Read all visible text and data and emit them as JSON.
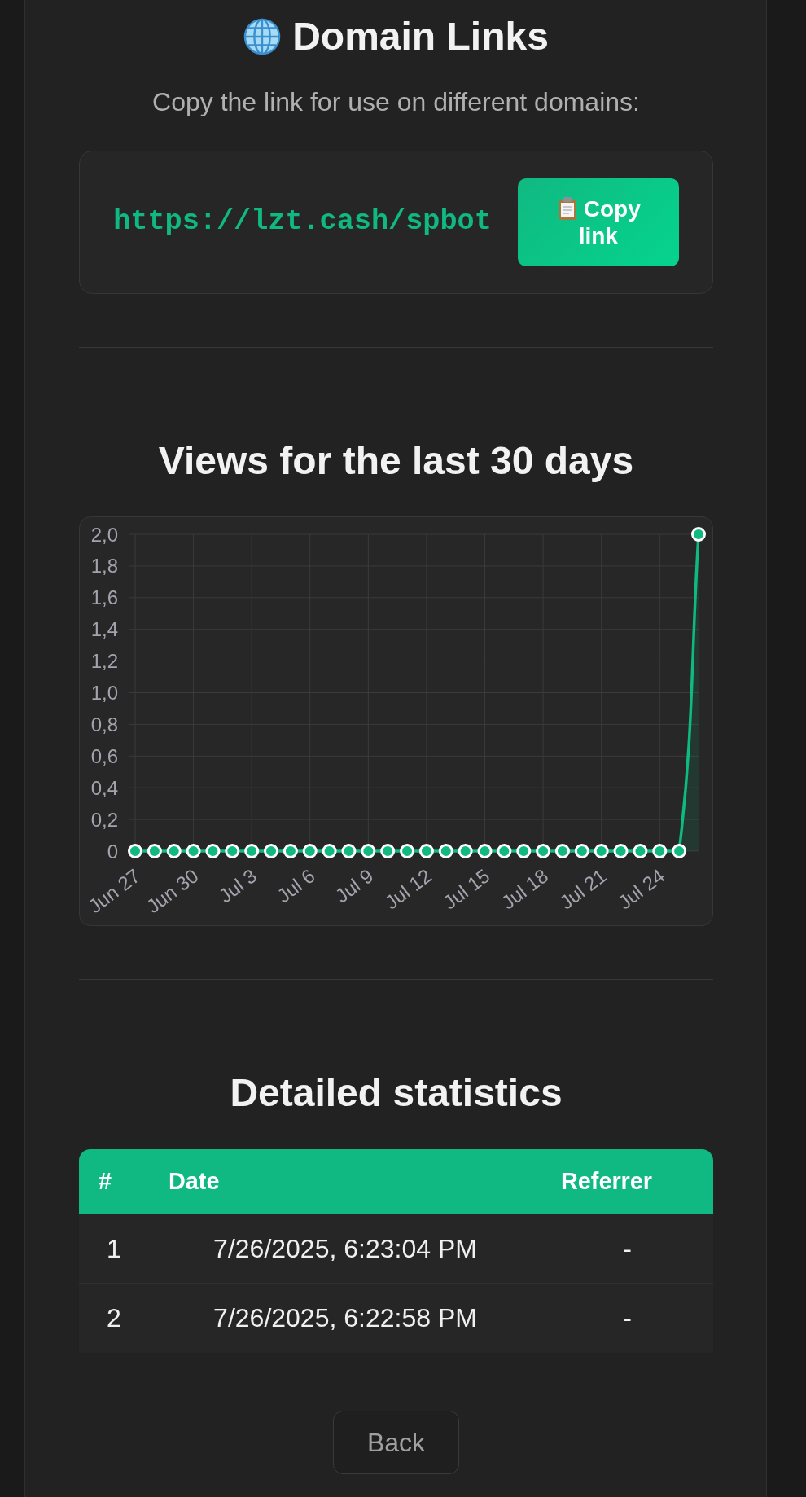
{
  "header": {
    "title": "Domain Links",
    "subtitle": "Copy the link for use on different domains:"
  },
  "link_card": {
    "url": "https://lzt.cash/spbot",
    "copy_button": "Copy link"
  },
  "views": {
    "title": "Views for the last 30 days",
    "chart_data": {
      "type": "area",
      "grid": true,
      "categories": [
        "Jun 27",
        null,
        null,
        "Jun 30",
        null,
        null,
        "Jul 3",
        null,
        null,
        "Jul 6",
        null,
        null,
        "Jul 9",
        null,
        null,
        "Jul 12",
        null,
        null,
        "Jul 15",
        null,
        null,
        "Jul 18",
        null,
        null,
        "Jul 21",
        null,
        null,
        "Jul 24",
        null,
        null
      ],
      "ylim": [
        0,
        2
      ],
      "yticks": [
        0,
        {
          "value": 0.2,
          "label": "0,2"
        },
        {
          "value": 0.4,
          "label": "0,4"
        },
        {
          "value": 0.6,
          "label": "0,6"
        },
        {
          "value": 0.8,
          "label": "0,8"
        },
        {
          "value": 1,
          "label": "1,0"
        },
        {
          "value": 1.2,
          "label": "1,2"
        },
        {
          "value": 1.4,
          "label": "1,4"
        },
        {
          "value": 1.6,
          "label": "1,6"
        },
        {
          "value": 1.8,
          "label": "1,8"
        },
        {
          "value": 2,
          "label": "2,0"
        }
      ],
      "series": [
        {
          "color": "#10b981",
          "values": [
            0,
            0,
            0,
            0,
            0,
            0,
            0,
            0,
            0,
            0,
            0,
            0,
            0,
            0,
            0,
            0,
            0,
            0,
            0,
            0,
            0,
            0,
            0,
            0,
            0,
            0,
            0,
            0,
            0,
            2
          ]
        }
      ]
    }
  },
  "statistics": {
    "title": "Detailed statistics",
    "columns": [
      "#",
      "Date",
      "Referrer"
    ],
    "rows": [
      [
        "1",
        "7/26/2025, 6:23:04 PM",
        "-"
      ],
      [
        "2",
        "7/26/2025, 6:22:58 PM",
        "-"
      ]
    ]
  },
  "back_button": "Back"
}
